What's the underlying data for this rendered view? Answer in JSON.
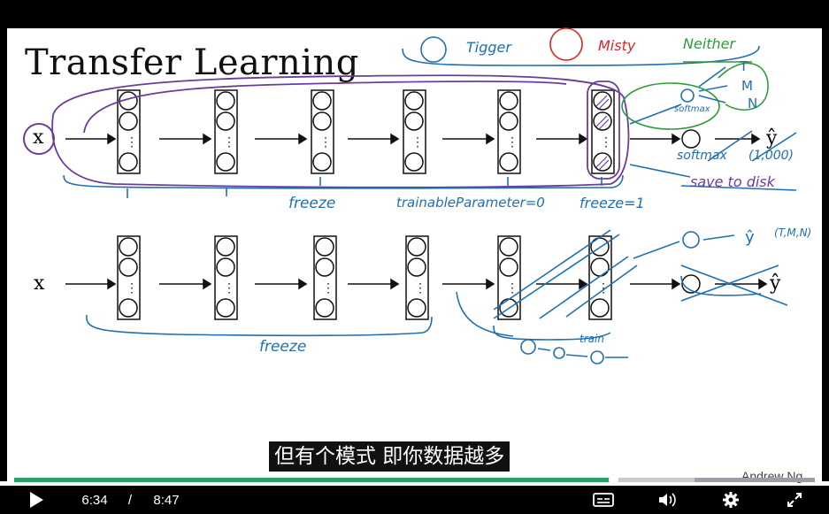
{
  "slide": {
    "title": "Transfer Learning",
    "input_label": "x",
    "output_label": "ŷ",
    "output_label_2": "ŷ",
    "annotations": {
      "tigger": "Tigger",
      "misty": "Misty",
      "neither": "Neither",
      "t": "T",
      "m": "M",
      "n": "N",
      "softmax1": "softmax",
      "softmax2": "softmax",
      "count": "(1,000)",
      "save_to_disk": "save to disk",
      "freeze1": "freeze",
      "trainable": "trainableParameter=0",
      "freeze_eq": "freeze=1",
      "freeze2": "freeze",
      "train": "train",
      "y_hat_small": "ŷ",
      "tmn": "(T,M,N)"
    }
  },
  "subtitle": "但有个模式 即你数据越多",
  "watermark": "Andrew Ng",
  "player": {
    "current_time": "6:34",
    "separator": "/",
    "duration": "8:47",
    "progress": 0.748,
    "buffered": 0.85,
    "play_icon": "play-icon",
    "captions_icon": "captions-icon",
    "volume_icon": "volume-icon",
    "settings_icon": "gear-icon",
    "fullscreen_icon": "fullscreen-icon",
    "colors": {
      "played": "#26a269",
      "buffered": "#c8ccd0",
      "track": "#9aa0a6"
    }
  }
}
